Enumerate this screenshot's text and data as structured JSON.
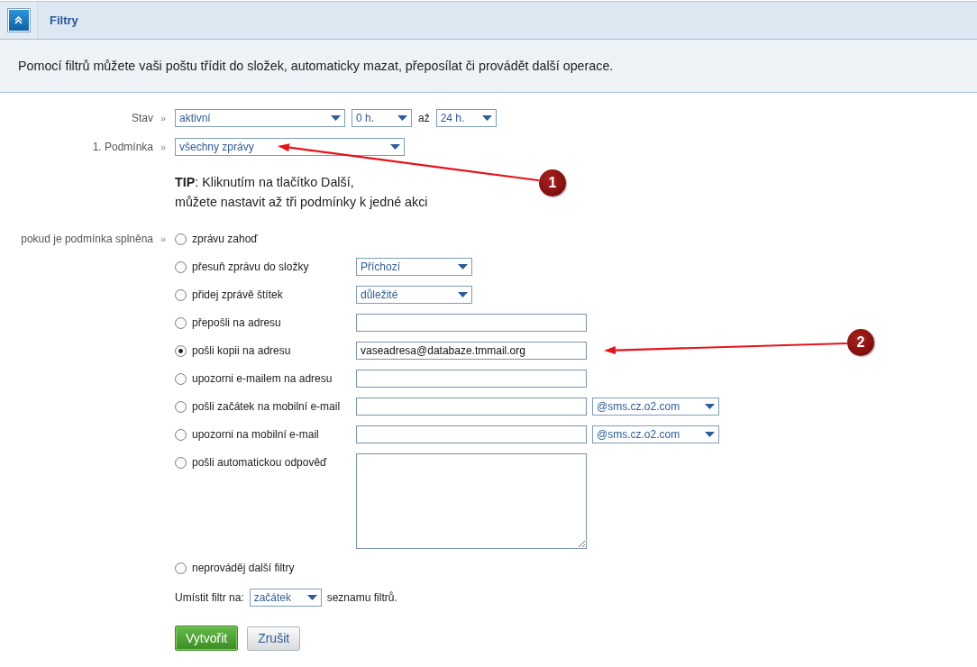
{
  "panel": {
    "title": "Filtry",
    "expanded": true
  },
  "description": "Pomocí filtrů můžete vaši poštu třídit do složek, automaticky mazat, přeposílat či provádět další operace.",
  "form": {
    "status": {
      "label": "Stav",
      "separator": "»",
      "state": "aktivní",
      "from": "0 h.",
      "to_label": "až",
      "to": "24 h."
    },
    "condition": {
      "label": "1. Podmínka",
      "separator": "»",
      "value": "všechny zprávy"
    },
    "tip": "**TIP**: Kliknutím na tlačítko Další,\nmůžete nastavit až tři podmínky k jedné akci",
    "actions_label": "pokud je podmínka splněna",
    "actions_separator": "»",
    "actions": [
      {
        "kind": "plain",
        "label": "zprávu zahoď",
        "selected": false
      },
      {
        "kind": "select",
        "label": "přesuň zprávu do složky",
        "selected": false,
        "value": "Příchozí"
      },
      {
        "kind": "select",
        "label": "přidej zprávě štítek",
        "selected": false,
        "value": "důležité"
      },
      {
        "kind": "input",
        "label": "přepošli na adresu",
        "selected": false
      },
      {
        "kind": "input",
        "label": "pošli kopii na adresu",
        "selected": true,
        "value": "vaseadresa@databaze.tmmail.org"
      },
      {
        "kind": "input",
        "label": "upozorni e-mailem na adresu",
        "selected": false
      },
      {
        "kind": "combo",
        "label": "pošli začátek na mobilní e-mail",
        "selected": false,
        "option": "@sms.cz.o2.com"
      },
      {
        "kind": "combo",
        "label": "upozorni na mobilní e-mail",
        "selected": false,
        "option": "@sms.cz.o2.com"
      },
      {
        "kind": "textarea",
        "label": "pošli automatickou odpověď",
        "selected": false
      },
      {
        "kind": "plain",
        "label": "neprováděj další filtry",
        "selected": false
      }
    ],
    "placement": {
      "label": "Umístit filtr na:",
      "value": "začátek",
      "suffix": "seznamu filtrů."
    },
    "buttons": [
      {
        "kind": "primary",
        "label": "Vytvořit"
      },
      {
        "kind": "secondary",
        "label": "Zrušit"
      }
    ]
  },
  "annotations": [
    {
      "number": "1"
    },
    {
      "number": "2"
    }
  ]
}
